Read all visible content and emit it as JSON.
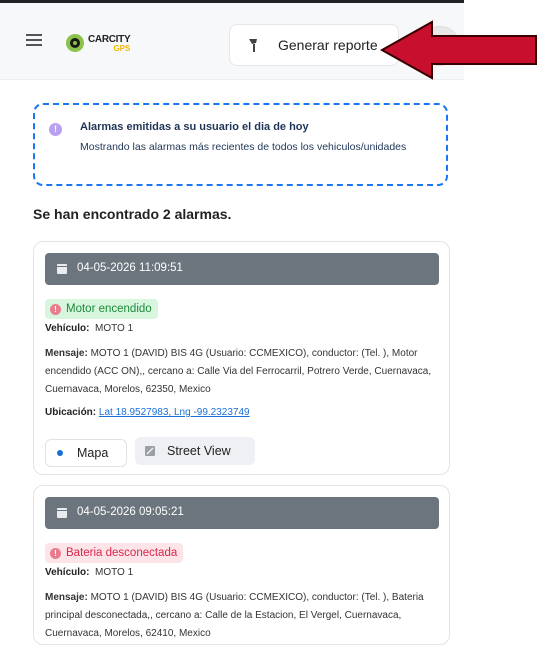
{
  "header": {
    "logo_car": "CARCITY",
    "logo_gps": "GPS",
    "report_button_label": "Generar reporte"
  },
  "info": {
    "icon": "!",
    "title": "Alarmas emitidas a su usuario el dia de hoy",
    "text": "Mostrando las alarmas más recientes de todos los vehiculos/unidades"
  },
  "summary": "Se han encontrado 2 alarmas.",
  "alarms": [
    {
      "date": "04-05-2026 11:09:51",
      "badge": "Motor encendido",
      "vehicle_label": "Vehículo:",
      "vehicle": "MOTO 1",
      "message_label": "Mensaje:",
      "message": "MOTO 1 (DAVID) BIS 4G (Usuario: CCMEXICO), conductor: (Tel. ), Motor encendido (ACC ON),, cercano a: Calle Via del Ferrocarril, Potrero Verde, Cuernavaca, Cuernavaca, Morelos, 62350, Mexico",
      "location_label": "Ubicación:",
      "location": "Lat 18.9527983, Lng -99.2323749",
      "map_button": "Mapa",
      "street_view_button": "Street View"
    },
    {
      "date": "04-05-2026 09:05:21",
      "badge": "Bateria desconectada",
      "vehicle_label": "Vehículo:",
      "vehicle": "MOTO 1",
      "message_label": "Mensaje:",
      "message": "MOTO 1 (DAVID) BIS 4G (Usuario: CCMEXICO), conductor: (Tel. ), Bateria principal desconectada,, cercano a: Calle de la Estacion, El Vergel, Cuernavaca, Cuernavaca, Morelos, 62410, Mexico"
    }
  ],
  "colors": {
    "accent_blue": "#1976f5",
    "date_bar": "#6c757d",
    "badge_green_bg": "#d8f5de",
    "badge_red_bg": "#fde4e8",
    "arrow_red": "#c8102e"
  },
  "icons": [
    "menu-icon",
    "logo-icon",
    "pin-icon",
    "avatar-icon",
    "info-icon",
    "calendar-icon",
    "alert-icon",
    "map-icon",
    "street-view-icon"
  ]
}
